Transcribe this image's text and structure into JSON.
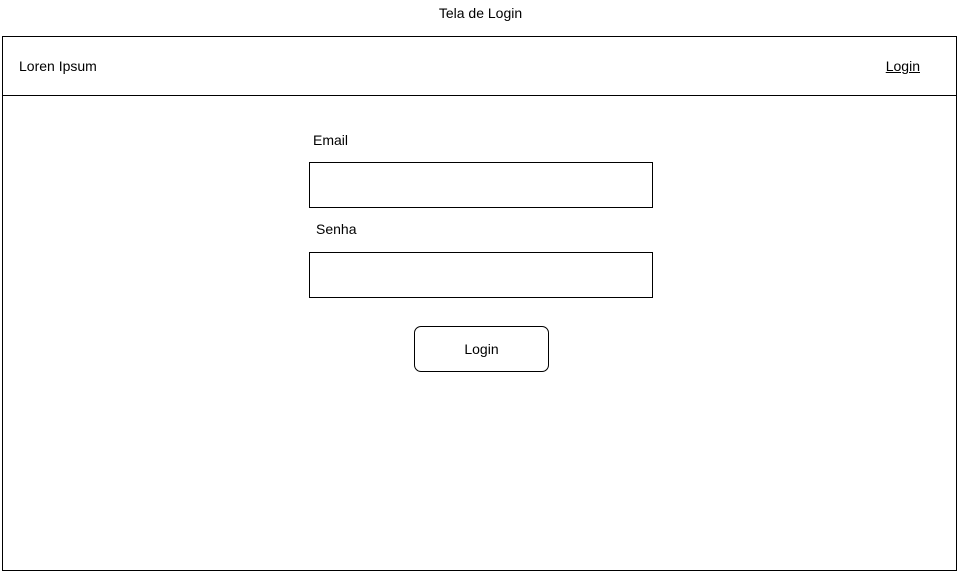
{
  "page": {
    "caption": "Tela de Login"
  },
  "header": {
    "brand": "Loren Ipsum",
    "login_link": "Login"
  },
  "form": {
    "email_label": "Email",
    "email_value": "",
    "email_placeholder": "",
    "password_label": "Senha",
    "password_value": "",
    "password_placeholder": "",
    "submit_label": "Login"
  },
  "colors": {
    "border": "#000000",
    "background": "#ffffff",
    "text": "#000000"
  }
}
